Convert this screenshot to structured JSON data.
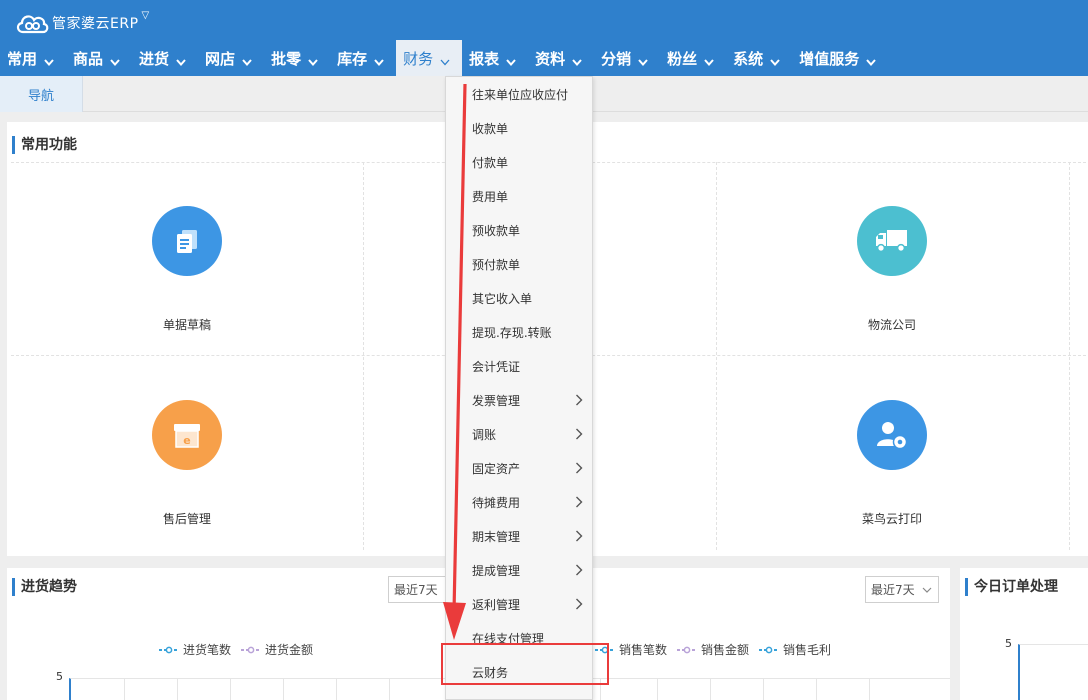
{
  "app": {
    "logo_text": "管家婆云ERP"
  },
  "menubar": [
    {
      "label": "常用"
    },
    {
      "label": "商品"
    },
    {
      "label": "进货"
    },
    {
      "label": "网店"
    },
    {
      "label": "批零"
    },
    {
      "label": "库存"
    },
    {
      "label": "财务",
      "active": true
    },
    {
      "label": "报表"
    },
    {
      "label": "资料"
    },
    {
      "label": "分销"
    },
    {
      "label": "粉丝"
    },
    {
      "label": "系统"
    },
    {
      "label": "增值服务"
    }
  ],
  "tabs": {
    "nav": "导航"
  },
  "common": {
    "title": "常用功能",
    "tiles": [
      {
        "label": "单据草稿",
        "icon": "document-icon",
        "color": "#3d96e4"
      },
      {
        "label": "物流公司",
        "icon": "truck-icon",
        "color": "#4cbfd0"
      },
      {
        "label": "售后管理",
        "icon": "package-icon",
        "color": "#f7a04a"
      },
      {
        "label": "菜鸟云打印",
        "icon": "user-settings-icon",
        "color": "#3d96e4"
      }
    ]
  },
  "purchase_trend": {
    "title": "进货趋势",
    "period": "最近7天",
    "legend": [
      "进货笔数",
      "进货金额"
    ],
    "y_top": "5"
  },
  "sales_trend": {
    "period": "最近7天",
    "legend": [
      "销售笔数",
      "销售金额",
      "销售毛利"
    ]
  },
  "today_orders": {
    "title": "今日订单处理",
    "y_top": "5"
  },
  "finance_menu": {
    "items": [
      {
        "label": "往来单位应收应付",
        "sub": false
      },
      {
        "label": "收款单",
        "sub": false
      },
      {
        "label": "付款单",
        "sub": false
      },
      {
        "label": "费用单",
        "sub": false
      },
      {
        "label": "预收款单",
        "sub": false
      },
      {
        "label": "预付款单",
        "sub": false
      },
      {
        "label": "其它收入单",
        "sub": false
      },
      {
        "label": "提现.存现.转账",
        "sub": false
      },
      {
        "label": "会计凭证",
        "sub": false
      },
      {
        "label": "发票管理",
        "sub": true
      },
      {
        "label": "调账",
        "sub": true
      },
      {
        "label": "固定资产",
        "sub": true
      },
      {
        "label": "待摊费用",
        "sub": true
      },
      {
        "label": "期末管理",
        "sub": true
      },
      {
        "label": "提成管理",
        "sub": true
      },
      {
        "label": "返利管理",
        "sub": true
      },
      {
        "label": "在线支付管理",
        "sub": false
      },
      {
        "label": "云财务",
        "sub": false,
        "highlighted": true
      }
    ]
  },
  "colors": {
    "brand": "#2f80cc",
    "annotation": "#ea3b3b"
  }
}
